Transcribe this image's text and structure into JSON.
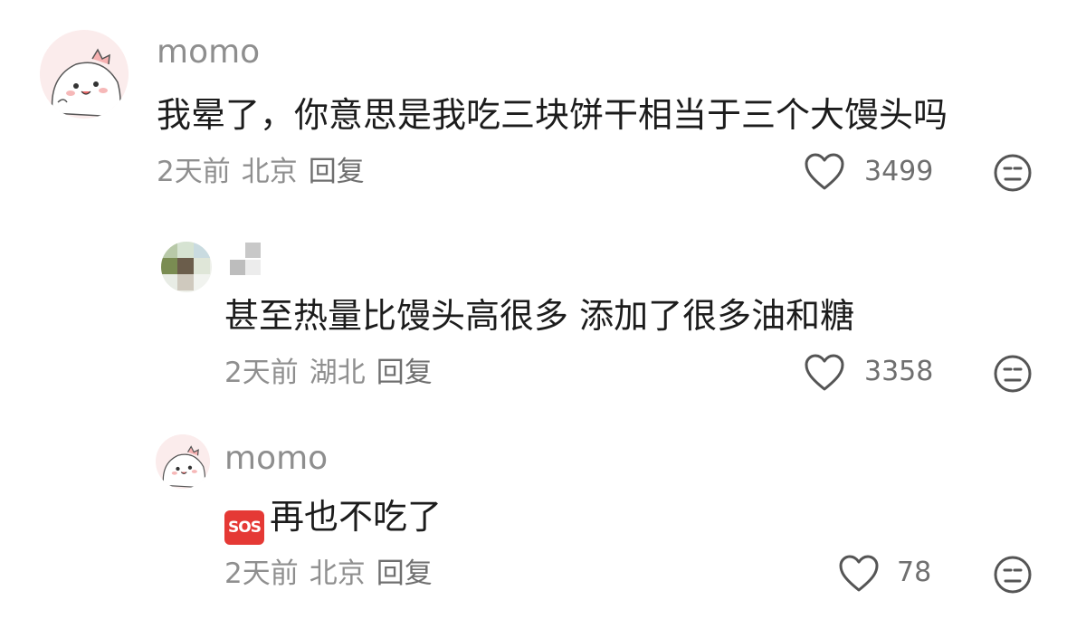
{
  "comments": [
    {
      "username": "momo",
      "text": "我晕了，你意思是我吃三块饼干相当于三个大馒头吗",
      "time": "2天前",
      "location": "北京",
      "reply_label": "回复",
      "likes": "3499"
    },
    {
      "username": "",
      "text": "甚至热量比馒头高很多 添加了很多油和糖",
      "time": "2天前",
      "location": "湖北",
      "reply_label": "回复",
      "likes": "3358"
    },
    {
      "username": "momo",
      "emoji": "SOS",
      "text": "再也不吃了",
      "time": "2天前",
      "location": "北京",
      "reply_label": "回复",
      "likes": "78"
    }
  ],
  "icons": {
    "like": "heart-outline-icon",
    "dislike": "neutral-face-icon"
  }
}
